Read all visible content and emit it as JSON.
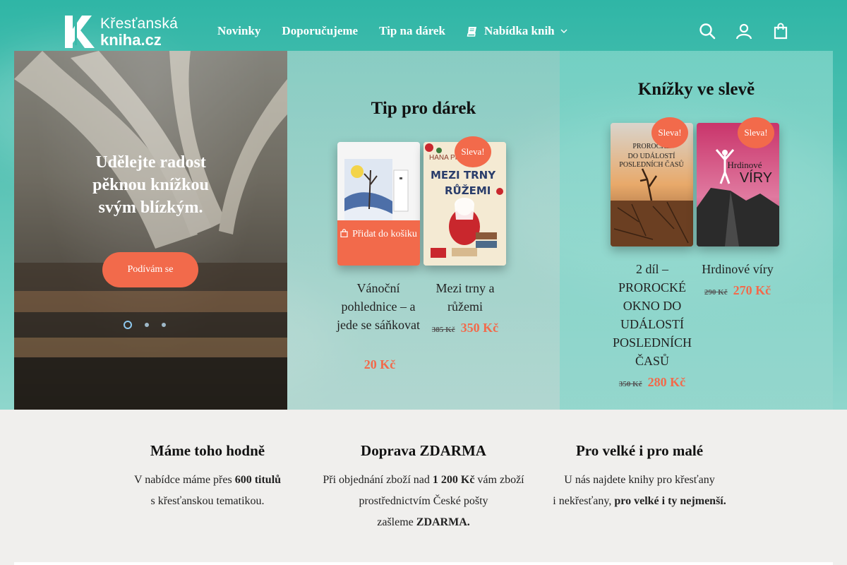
{
  "logo": {
    "line1": "Křesťanská",
    "line2": "kniha.cz"
  },
  "nav": {
    "items": [
      {
        "label": "Novinky"
      },
      {
        "label": "Doporučujeme"
      },
      {
        "label": "Tip na dárek"
      },
      {
        "label": "Nabídka knih"
      }
    ]
  },
  "header_icons": [
    "search-icon",
    "account-icon",
    "shopping-bag-icon"
  ],
  "hero": {
    "text": "Udělejte radost pěknou knížkou svým blízkým.",
    "button": "Podívám se",
    "dots": 3,
    "active_dot": 1
  },
  "gift": {
    "title": "Tip pro dárek",
    "add_to_cart": "Přidat do košiku",
    "books": [
      {
        "title": "Vánoční pohlednice – a jede se sáňkovat",
        "old_price": "",
        "price": "20 Kč",
        "sale": ""
      },
      {
        "title": "Mezi trny a růžemi",
        "old_price": "385 Kč",
        "price": "350 Kč",
        "sale": "Sleva!",
        "cover_author": "HANA PIN",
        "cover_title1": "MEZI TRNY",
        "cover_title2": "RŮŽEMI"
      }
    ]
  },
  "sale": {
    "title": "Knížky ve slevě",
    "books": [
      {
        "title": "2 díl – PROROCKÉ OKNO DO UDÁLOSTÍ POSLEDNÍCH ČASŮ",
        "old_price": "350 Kč",
        "price": "280 Kč",
        "sale": "Sleva!",
        "cover_line1": "PROROCKÉ",
        "cover_line2": "DO UDÁLOSTÍ",
        "cover_line3": "POSLEDNÍCH ČASŮ"
      },
      {
        "title": "Hrdinové víry",
        "old_price": "290 Kč",
        "price": "270 Kč",
        "sale": "Sleva!",
        "cover_title1": "Hrdinové",
        "cover_title2": "VÍRY"
      }
    ]
  },
  "features": [
    {
      "title": "Máme toho hodně",
      "p1_a": "V nabídce máme přes ",
      "p1_b": "600 titulů",
      "p2": "s křesťanskou tematikou."
    },
    {
      "title": "Doprava ZDARMA",
      "p1_a": "Při objednání zboží nad ",
      "p1_b": "1 200 Kč",
      "p1_c": " vám zboží",
      "p2": "prostřednictvím České pošty",
      "p3_a": "zašleme ",
      "p3_b": "ZDARMA."
    },
    {
      "title": "Pro velké i pro malé",
      "p1": "U nás najdete knihy pro křesťany",
      "p2_a": "i nekřesťany, ",
      "p2_b": "pro velké i ty nejmenší."
    }
  ],
  "colors": {
    "accent": "#f26a4b",
    "teal": "#3bbaa9",
    "bg": "#f0efed"
  }
}
